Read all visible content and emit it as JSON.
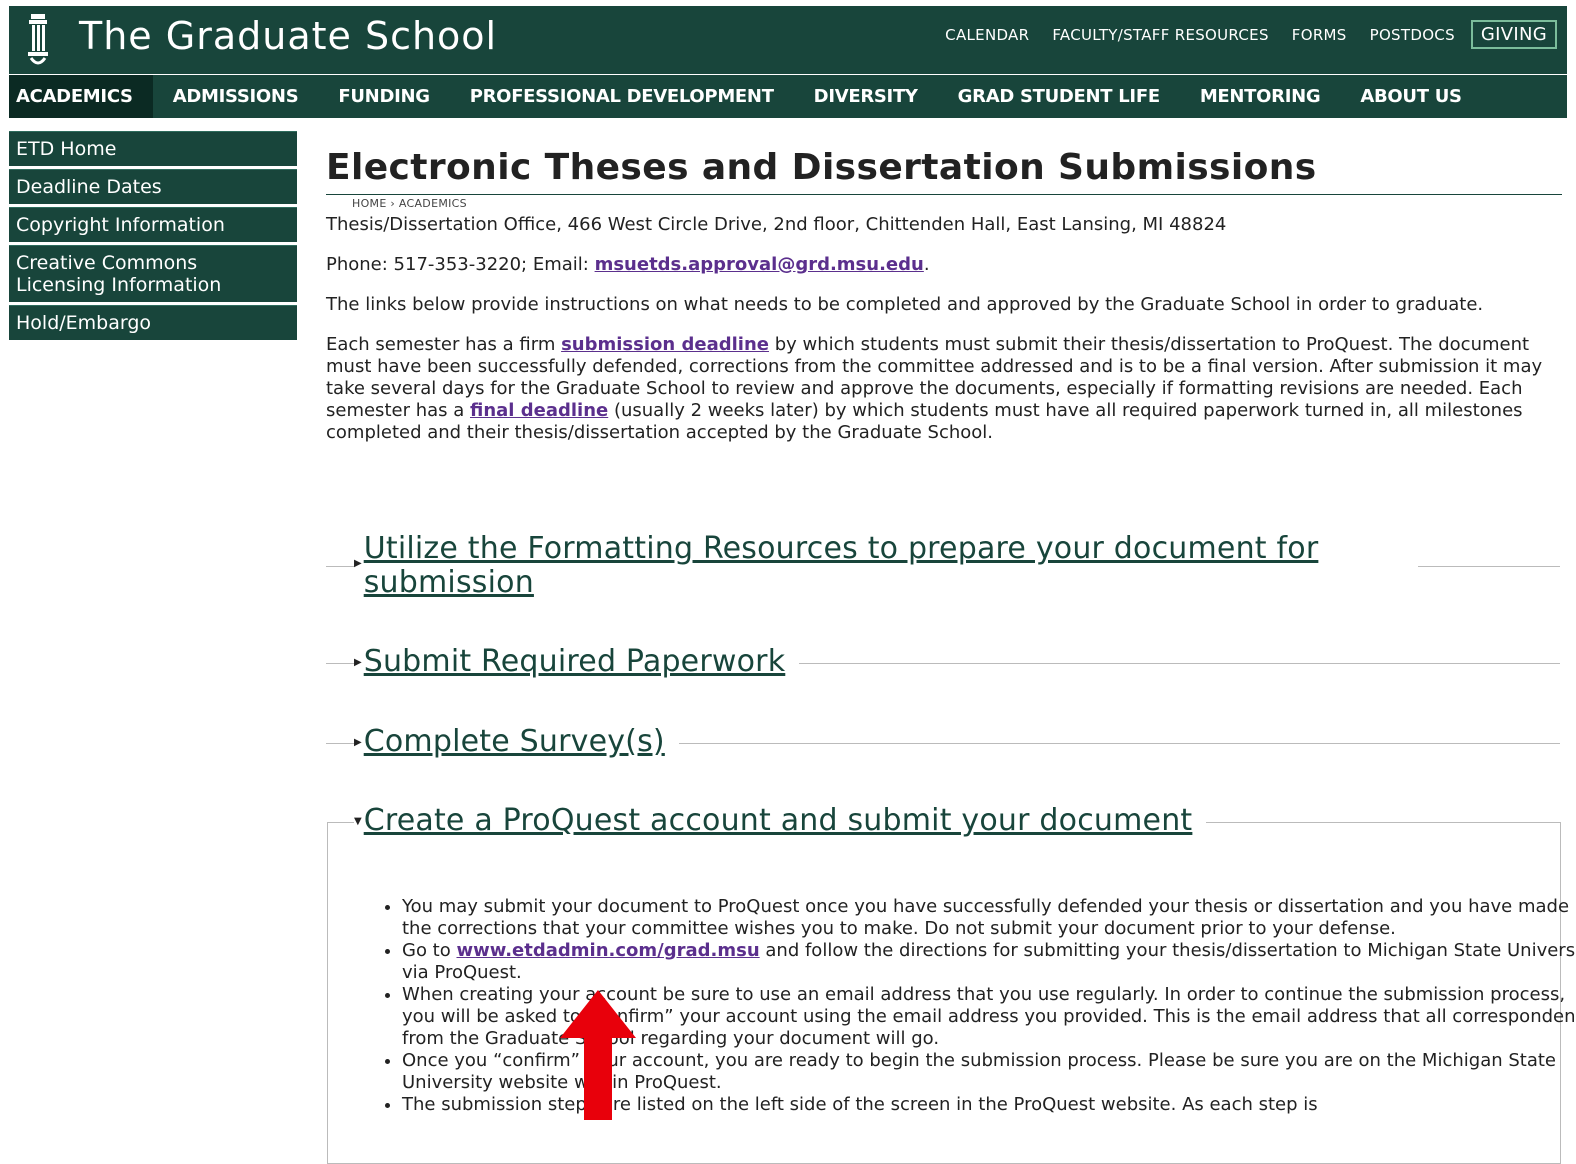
{
  "header": {
    "site_title": "The Graduate School",
    "utility_links": [
      "CALENDAR",
      "FACULTY/STAFF RESOURCES",
      "FORMS",
      "POSTDOCS"
    ],
    "giving_label": "GIVING"
  },
  "nav": {
    "items": [
      "ACADEMICS",
      "ADMISSIONS",
      "FUNDING",
      "PROFESSIONAL DEVELOPMENT",
      "DIVERSITY",
      "GRAD STUDENT LIFE",
      "MENTORING",
      "ABOUT US"
    ]
  },
  "sidebar": {
    "items": [
      "ETD Home",
      "Deadline Dates",
      "Copyright Information",
      "Creative Commons Licensing Information",
      "Hold/Embargo"
    ]
  },
  "page": {
    "title": "Electronic Theses and Dissertation Submissions",
    "breadcrumb": "HOME › ACADEMICS",
    "address": "Thesis/Dissertation Office, 466 West Circle Drive, 2nd floor, Chittenden Hall, East Lansing, MI 48824",
    "phone_prefix": "Phone: 517-353-3220; Email: ",
    "email": "msuetds.approval@grd.msu.edu",
    "phone_suffix": ".",
    "intro": "The links below provide instructions on what needs to be completed and approved by the Graduate School in order to graduate.",
    "deadline_p1": "Each semester has a firm ",
    "deadline_link1": "submission deadline",
    "deadline_p2": " by which students must submit their thesis/dissertation to ProQuest. The document must have been successfully defended, corrections from the committee addressed and is to be a final version. After submission it may take several days for the Graduate School to review and approve the documents, especially if formatting revisions are needed. Each semester has a ",
    "deadline_link2": "final deadline",
    "deadline_p3": " (usually 2 weeks later) by which students must have all required paperwork turned in, all milestones completed and their thesis/dissertation accepted by the Graduate School."
  },
  "accordions": [
    {
      "title": "Utilize the Formatting Resources to prepare your document for submission",
      "expanded": false
    },
    {
      "title": "Submit Required Paperwork",
      "expanded": false
    },
    {
      "title": "Complete Survey(s)",
      "expanded": false
    },
    {
      "title": "Create a ProQuest account and submit your document",
      "expanded": true
    }
  ],
  "proquest": {
    "item1": "You may submit your document to ProQuest once you have successfully defended your thesis or dissertation and you have made the corrections that your committee wishes you to make.  Do not submit your document prior to your defense.",
    "item2_prefix": "Go to ",
    "item2_link": "www.etdadmin.com/grad.msu",
    "item2_suffix": " and follow the directions for submitting your thesis/dissertation to Michigan State University via ProQuest.",
    "item3": "When creating your account be sure to use an email address that you use regularly. In order to continue the submission process, you will be asked to “confirm” your account using the email address you provided. This is the email address that all correspondence from the Graduate School regarding your document will go.",
    "item4": "Once you “confirm” your account, you are ready to begin the submission process. Please be sure you are on the Michigan State University website within ProQuest.",
    "item5": "The submission steps are listed on the left side of the screen in the ProQuest website. As each step is"
  },
  "colors": {
    "brand_green": "#18453b",
    "link_purple": "#5b2f8d",
    "annotation_red": "#e8000b"
  }
}
